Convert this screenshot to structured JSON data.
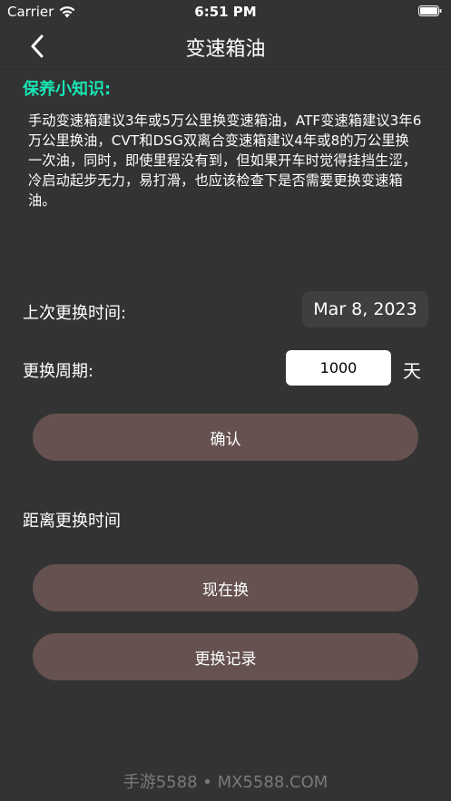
{
  "status_bar": {
    "carrier": "Carrier",
    "time": "6:51 PM",
    "icons": [
      "wifi-icon",
      "battery-icon"
    ]
  },
  "nav": {
    "back_icon": "chevron-left-icon",
    "title": "变速箱油"
  },
  "tips": {
    "title": "保养小知识:",
    "body": "手动变速箱建议3年或5万公里换变速箱油，ATF变速箱建议3年6万公里换油，CVT和DSG双离合变速箱建议4年或8的万公里换一次油，同时，即使里程没有到，但如果开车时觉得挂挡生涩，冷启动起步无力，易打滑，也应该检查下是否需要更换变速箱油。"
  },
  "form": {
    "last_change_label": "上次更换时间:",
    "last_change_date": "Mar 8, 2023",
    "period_label": "更换周期:",
    "period_value": "1000",
    "period_unit": "天",
    "confirm_label": "确认"
  },
  "remaining": {
    "label": "距离更换时间"
  },
  "actions": {
    "change_now_label": "现在换",
    "history_label": "更换记录"
  },
  "watermark": "手游5588 • MX5588.COM",
  "colors": {
    "background": "#333333",
    "accent_teal": "#17e6b4",
    "button_fill": "#655250",
    "date_fill": "#3f3f3f",
    "watermark_text": "#7a7a7a"
  }
}
